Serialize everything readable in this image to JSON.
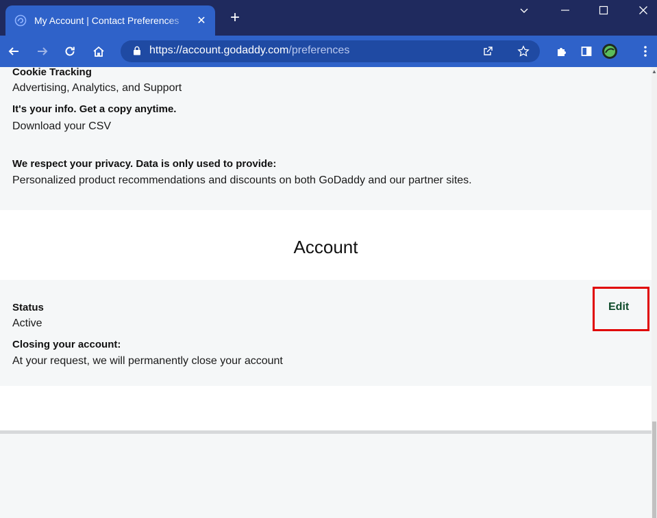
{
  "browser": {
    "tab_title": "My Account | Contact Preferences",
    "url_host": "https://account.godaddy.com",
    "url_path": "/preferences"
  },
  "preferences": {
    "cookie_label": "Cookie Tracking",
    "cookie_value": "Advertising, Analytics, and Support",
    "info_label": "It's your info. Get a copy anytime.",
    "info_value": "Download your CSV",
    "privacy_label": "We respect your privacy. Data is only used to provide:",
    "privacy_value": "Personalized product recommendations and discounts on both GoDaddy and our partner sites."
  },
  "account": {
    "title": "Account",
    "status_label": "Status",
    "status_value": "Active",
    "edit_label": "Edit",
    "closing_label": "Closing your account:",
    "closing_value": "At your request, we will permanently close your account"
  },
  "colors": {
    "titlebar": "#1f2a5e",
    "toolbar": "#2f62c9",
    "panel_bg": "#f5f7f8",
    "edit_link": "#0e4b2a",
    "highlight": "#e00000"
  }
}
